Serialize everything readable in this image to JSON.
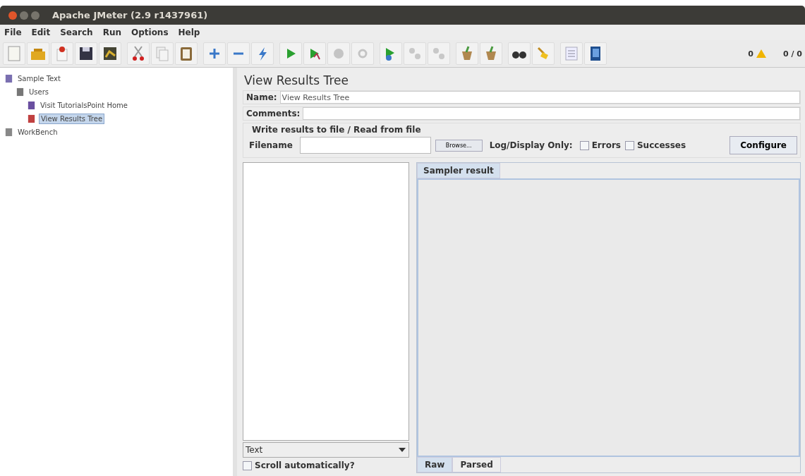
{
  "window": {
    "title": "Apache JMeter (2.9 r1437961)"
  },
  "menu": [
    {
      "label": "File"
    },
    {
      "label": "Edit"
    },
    {
      "label": "Search"
    },
    {
      "label": "Run"
    },
    {
      "label": "Options"
    },
    {
      "label": "Help"
    }
  ],
  "status": {
    "warnings": "0",
    "threads": "0 / 0"
  },
  "tree": [
    {
      "label": "Sample Text",
      "kind": "plan",
      "selected": false,
      "children": [
        {
          "label": "Users",
          "kind": "group",
          "selected": false,
          "children": [
            {
              "label": "Visit TutorialsPoint Home",
              "kind": "sampler",
              "selected": false
            },
            {
              "label": "View Results Tree",
              "kind": "listener",
              "selected": true
            }
          ]
        }
      ]
    },
    {
      "label": "WorkBench",
      "kind": "bench",
      "selected": false
    }
  ],
  "panel": {
    "title": "View Results Tree",
    "name_label": "Name:",
    "name_value": "View Results Tree",
    "comments_label": "Comments:",
    "file_group": "Write results to file / Read from file",
    "filename_label": "Filename",
    "browse": "Browse...",
    "log_label": "Log/Display Only:",
    "checks": [
      {
        "label": "Errors",
        "checked": false
      },
      {
        "label": "Successes",
        "checked": false
      }
    ],
    "configure": "Configure",
    "renderer": "Text",
    "scroll": {
      "label": "Scroll automatically?",
      "checked": false
    },
    "tabs": [
      {
        "label": "Sampler result",
        "selected": true
      }
    ],
    "bottom_tabs": [
      {
        "label": "Raw",
        "selected": true
      },
      {
        "label": "Parsed",
        "selected": false
      }
    ]
  }
}
